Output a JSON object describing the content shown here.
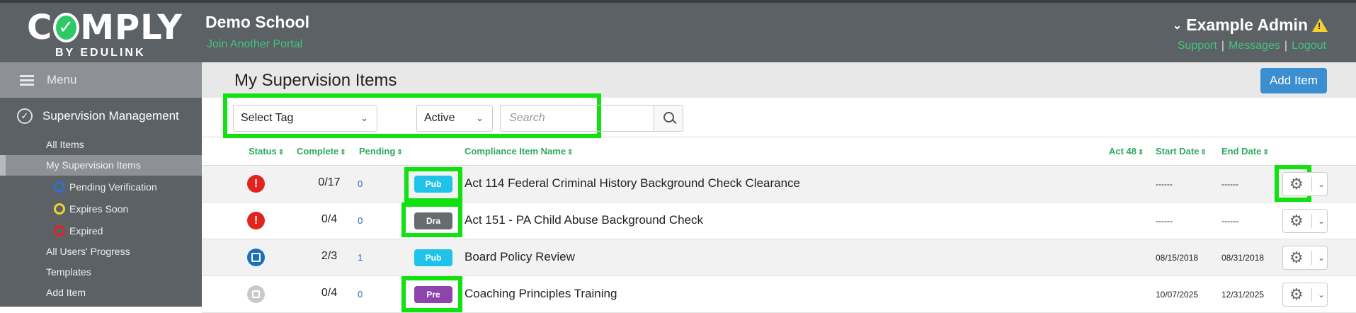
{
  "brand": {
    "name_before": "C",
    "name_after": "MPLY",
    "sub": "BY EDULINK",
    "check": "✓"
  },
  "header": {
    "school": "Demo School",
    "join_link": "Join Another Portal",
    "admin_name": "Example Admin",
    "links": [
      "Support",
      "Messages",
      "Logout"
    ]
  },
  "sidebar": {
    "menu_label": "Menu",
    "section_label": "Supervision Management",
    "items": [
      {
        "label": "All Items"
      },
      {
        "label": "My Supervision Items"
      },
      {
        "label": "Pending Verification",
        "color": "#2a73c9"
      },
      {
        "label": "Expires Soon",
        "color": "#f2d32b"
      },
      {
        "label": "Expired",
        "color": "#e1241f"
      },
      {
        "label": "All Users' Progress"
      },
      {
        "label": "Templates"
      },
      {
        "label": "Add Item"
      }
    ]
  },
  "main": {
    "title": "My Supervision Items",
    "add_button": "Add Item",
    "filters": {
      "tag_select": "Select Tag",
      "status_select": "Active",
      "search_placeholder": "Search"
    },
    "columns": {
      "status": "Status",
      "complete": "Complete",
      "pending": "Pending",
      "name": "Compliance Item Name",
      "act48": "Act 48",
      "start": "Start Date",
      "end": "End Date"
    },
    "rows": [
      {
        "status": "!",
        "complete": "0/17",
        "pending": "0",
        "badge": "Pub",
        "name": "Act 114 Federal Criminal History Background Check Clearance",
        "start": "------",
        "end": "------"
      },
      {
        "status": "!",
        "complete": "0/4",
        "pending": "0",
        "badge": "Dra",
        "name": "Act 151 - PA Child Abuse Background Check",
        "start": "------",
        "end": "------"
      },
      {
        "status": "",
        "complete": "2/3",
        "pending": "1",
        "badge": "Pub",
        "name": "Board Policy Review",
        "start": "08/15/2018",
        "end": "08/31/2018"
      },
      {
        "status": "",
        "complete": "0/4",
        "pending": "0",
        "badge": "Pre",
        "name": "Coaching Principles Training",
        "start": "10/07/2025",
        "end": "12/31/2025"
      }
    ]
  },
  "colors": {
    "accent_green": "#2eaa5c",
    "highlight": "#11e011",
    "primary_blue": "#3b8fd0"
  },
  "icons": [
    "menu-icon",
    "check-circle-icon",
    "search-icon",
    "gear-icon",
    "chevron-down-icon",
    "warning-icon",
    "sort-icon"
  ]
}
